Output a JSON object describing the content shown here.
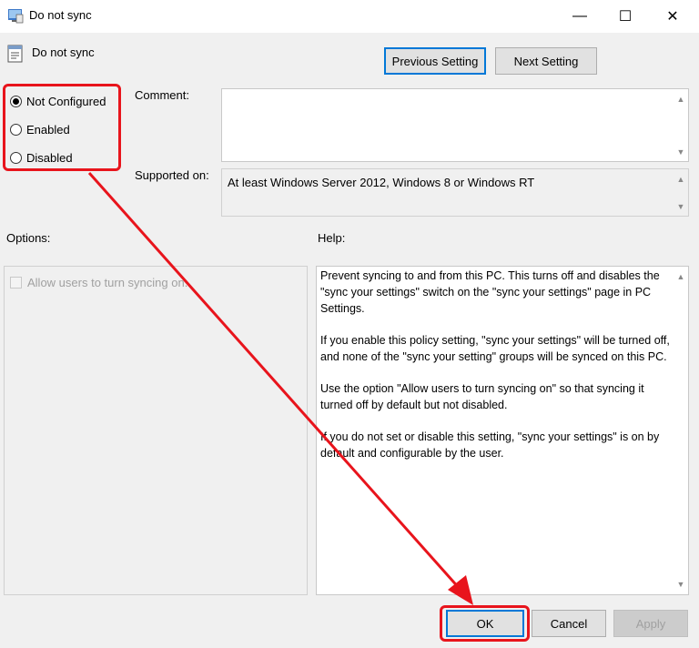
{
  "window": {
    "title": "Do not sync",
    "minimize_glyph": "—",
    "maximize_glyph": "☐",
    "close_glyph": "✕"
  },
  "header": {
    "policy_name": "Do not sync",
    "previous_label": "Previous Setting",
    "next_label": "Next Setting"
  },
  "state": {
    "options": [
      {
        "label": "Not Configured",
        "checked": true
      },
      {
        "label": "Enabled",
        "checked": false
      },
      {
        "label": "Disabled",
        "checked": false
      }
    ]
  },
  "fields": {
    "comment_label": "Comment:",
    "comment_value": "",
    "supported_label": "Supported on:",
    "supported_value": "At least Windows Server 2012, Windows 8 or Windows RT"
  },
  "options_pane": {
    "heading": "Options:",
    "checkbox_label": "Allow users to turn syncing on."
  },
  "help_pane": {
    "heading": "Help:",
    "paragraphs": [
      "Prevent syncing to and from this PC.  This turns off and disables the \"sync your settings\" switch on the \"sync your settings\" page in PC Settings.",
      "If you enable this policy setting, \"sync your settings\" will be turned off, and none of the \"sync your setting\" groups will be synced on this PC.",
      "Use the option \"Allow users to turn syncing on\" so that syncing it turned off by default but not disabled.",
      "If you do not set or disable this setting, \"sync your settings\" is on by default and configurable by the user."
    ]
  },
  "footer": {
    "ok_label": "OK",
    "cancel_label": "Cancel",
    "apply_label": "Apply"
  },
  "colors": {
    "annotation_red": "#e8141c",
    "focus_blue": "#0078d7"
  },
  "icons": {
    "title": "policy-window-icon",
    "policy": "policy-setting-icon",
    "scroll_up": "scroll-up-icon",
    "scroll_down": "scroll-down-icon"
  }
}
